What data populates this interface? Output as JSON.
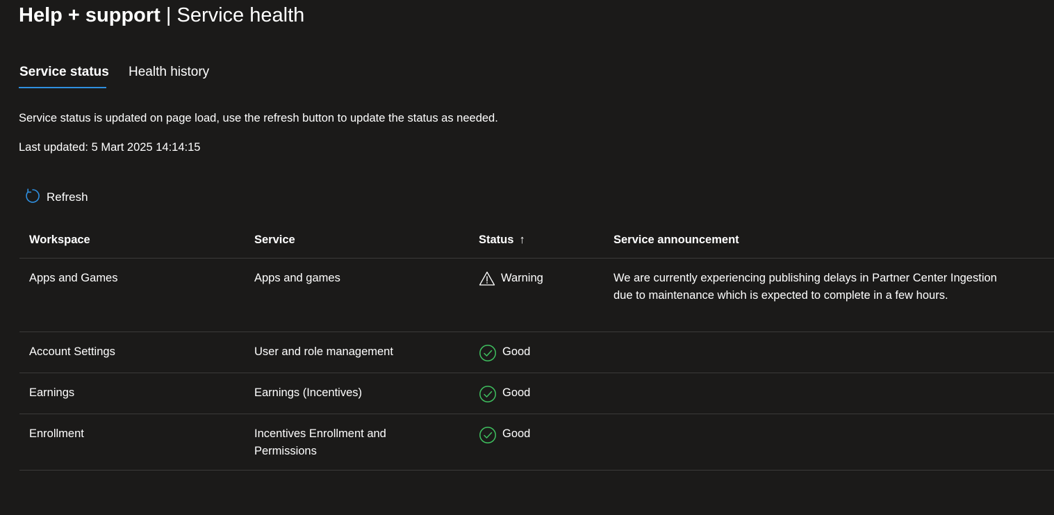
{
  "header": {
    "title_main": "Help + support",
    "title_sep": " | ",
    "title_sub": "Service health"
  },
  "tabs": [
    {
      "label": "Service status",
      "active": true
    },
    {
      "label": "Health history",
      "active": false
    }
  ],
  "description": "Service status is updated on page load, use the refresh button to update the status as needed.",
  "last_updated": "Last updated: 5 Mart 2025 14:14:15",
  "toolbar": {
    "refresh_label": "Refresh",
    "refresh_icon": "refresh-icon"
  },
  "table": {
    "columns": [
      "Workspace",
      "Service",
      "Status",
      "Service announcement"
    ],
    "sort_indicator": "↑",
    "rows": [
      {
        "workspace": "Apps and Games",
        "service": "Apps and games",
        "status": "Warning",
        "status_icon": "warning-icon",
        "announcement": "We are currently experiencing publishing delays in Partner Center Ingestion due to maintenance which is expected to complete in a few hours."
      },
      {
        "workspace": "Account Settings",
        "service": "User and role management",
        "status": "Good",
        "status_icon": "check-circle-icon",
        "announcement": ""
      },
      {
        "workspace": "Earnings",
        "service": "Earnings (Incentives)",
        "status": "Good",
        "status_icon": "check-circle-icon",
        "announcement": ""
      },
      {
        "workspace": "Enrollment",
        "service": "Incentives Enrollment and Permissions",
        "status": "Good",
        "status_icon": "check-circle-icon",
        "announcement": ""
      }
    ]
  },
  "colors": {
    "background": "#1b1a19",
    "text": "#ffffff",
    "accent": "#2f8fdf",
    "good": "#3fc05f",
    "divider": "#3b3a39"
  }
}
